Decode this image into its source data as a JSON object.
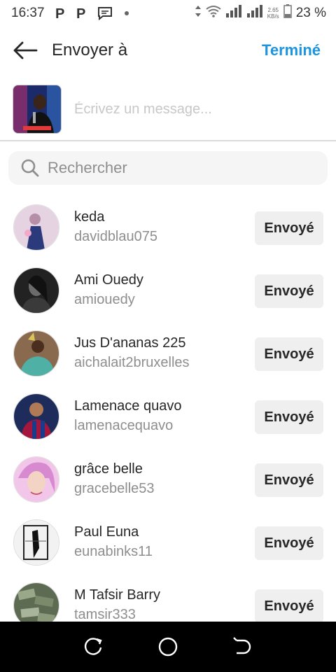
{
  "status_bar": {
    "time": "16:37",
    "net_speed_value": "2.65",
    "net_speed_unit": "KB/s",
    "battery": "23 %"
  },
  "header": {
    "title": "Envoyer à",
    "done_label": "Terminé",
    "accent_color": "#1b95e0"
  },
  "compose": {
    "placeholder": "Écrivez un message..."
  },
  "search": {
    "placeholder": "Rechercher"
  },
  "contacts": [
    {
      "name": "keda",
      "username": "davidblau075",
      "status": "Envoyé"
    },
    {
      "name": "Ami Ouedy",
      "username": "amiouedy",
      "status": "Envoyé"
    },
    {
      "name": "Jus D'ananas 225",
      "username": "aichalait2bruxelles",
      "status": "Envoyé"
    },
    {
      "name": "Lamenace quavo",
      "username": "lamenacequavo",
      "status": "Envoyé"
    },
    {
      "name": "grâce belle",
      "username": "gracebelle53",
      "status": "Envoyé"
    },
    {
      "name": "Paul Euna",
      "username": "eunabinks11",
      "status": "Envoyé"
    },
    {
      "name": "M Tafsir Barry",
      "username": "tamsir333",
      "status": "Envoyé"
    }
  ]
}
